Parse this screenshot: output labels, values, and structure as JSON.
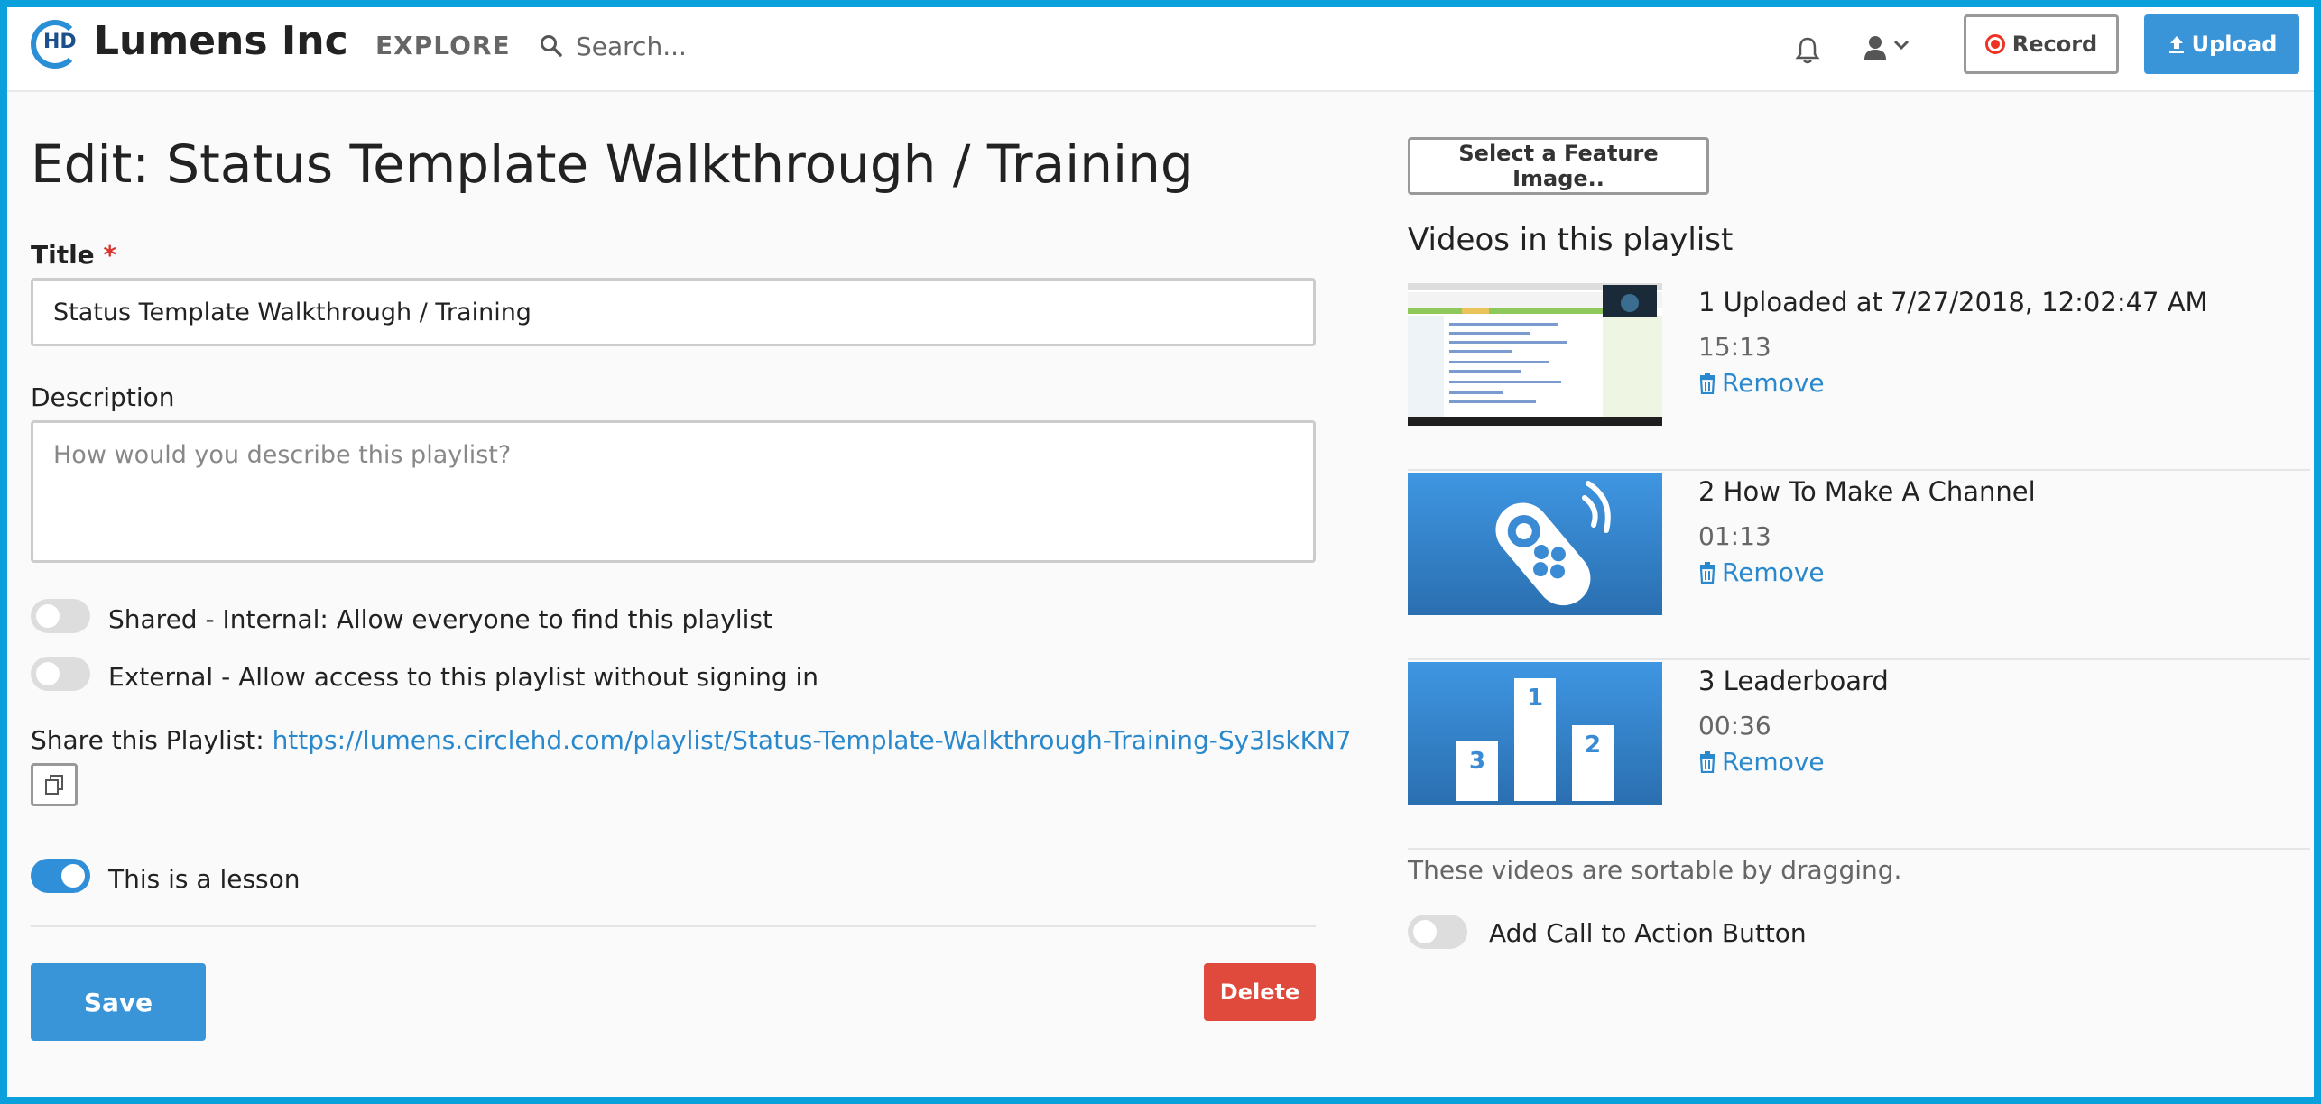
{
  "header": {
    "logo_badge": "HD",
    "brand": "Lumens Inc",
    "explore": "EXPLORE",
    "search_placeholder": "Search...",
    "record_label": "Record",
    "upload_label": "Upload"
  },
  "form": {
    "page_title": "Edit: Status Template Walkthrough / Training",
    "title_label": "Title",
    "title_required_mark": "*",
    "title_value": "Status Template Walkthrough / Training",
    "description_label": "Description",
    "description_placeholder": "How would you describe this playlist?",
    "toggles": [
      {
        "label": "Shared - Internal: Allow everyone to find this playlist",
        "on": false
      },
      {
        "label": "External - Allow access to this playlist without signing in",
        "on": false
      },
      {
        "label": "This is a lesson",
        "on": true
      }
    ],
    "share_label": "Share this Playlist:",
    "share_url": "https://lumens.circlehd.com/playlist/Status-Template-Walkthrough-Training-Sy3lskKN7",
    "save_label": "Save",
    "delete_label": "Delete"
  },
  "playlist": {
    "feature_image_button": "Select a Feature Image..",
    "heading": "Videos in this playlist",
    "videos": [
      {
        "title": "1 Uploaded at 7/27/2018, 12:02:47 AM",
        "duration": "15:13",
        "remove_label": "Remove",
        "thumb": "screenshot-thumb"
      },
      {
        "title": "2 How To Make A Channel",
        "duration": "01:13",
        "remove_label": "Remove",
        "thumb": "remote-control-icon"
      },
      {
        "title": "3 Leaderboard",
        "duration": "00:36",
        "remove_label": "Remove",
        "thumb": "podium-icon",
        "podium": [
          "1",
          "2",
          "3"
        ]
      }
    ],
    "sortable_note": "These videos are sortable by dragging.",
    "cta_toggle": {
      "label": "Add Call to Action Button",
      "on": false
    }
  },
  "colors": {
    "accent": "#3a95d8",
    "link": "#2a88cc",
    "danger": "#e04a3c",
    "frame": "#0aa0dc"
  }
}
